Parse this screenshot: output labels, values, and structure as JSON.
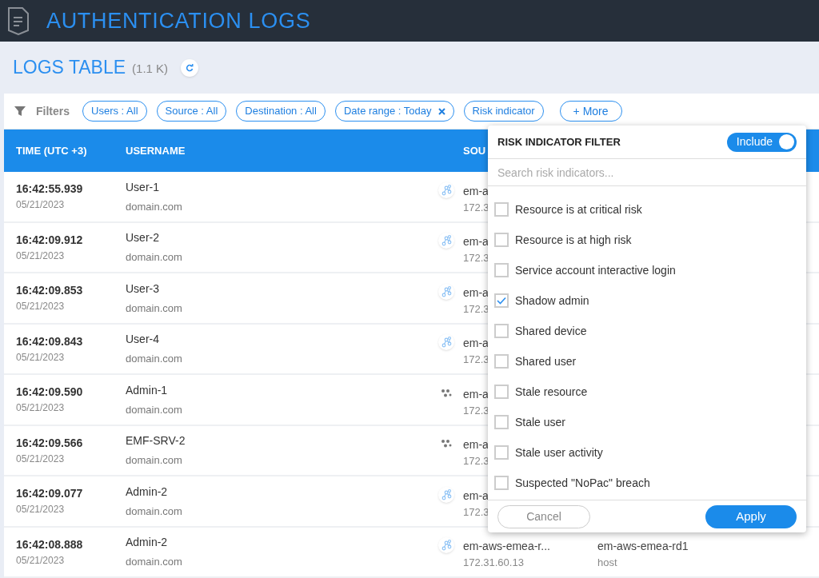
{
  "header": {
    "title": "AUTHENTICATION LOGS"
  },
  "section": {
    "title": "LOGS TABLE",
    "count": "(1.1 K)"
  },
  "filters": {
    "label": "Filters",
    "chips": [
      {
        "label": "Users : All",
        "removable": false
      },
      {
        "label": "Source : All",
        "removable": false
      },
      {
        "label": "Destination : All",
        "removable": false
      },
      {
        "label": "Date range : Today",
        "removable": true
      },
      {
        "label": "Risk indicator",
        "removable": false
      }
    ],
    "more": "+ More"
  },
  "table": {
    "columns": [
      "TIME (UTC +3)",
      "USERNAME",
      "SOU"
    ],
    "rows": [
      {
        "time": "16:42:55.939",
        "date": "05/21/2023",
        "user": "User-1",
        "domain": "domain.com",
        "kind": "link",
        "source": "em-a",
        "source_ip": "172.3"
      },
      {
        "time": "16:42:09.912",
        "date": "05/21/2023",
        "user": "User-2",
        "domain": "domain.com",
        "kind": "link",
        "source": "em-a",
        "source_ip": "172.3"
      },
      {
        "time": "16:42:09.853",
        "date": "05/21/2023",
        "user": "User-3",
        "domain": "domain.com",
        "kind": "link",
        "source": "em-a",
        "source_ip": "172.3"
      },
      {
        "time": "16:42:09.843",
        "date": "05/21/2023",
        "user": "User-4",
        "domain": "domain.com",
        "kind": "link",
        "source": "em-a",
        "source_ip": "172.3"
      },
      {
        "time": "16:42:09.590",
        "date": "05/21/2023",
        "user": "Admin-1",
        "domain": "domain.com",
        "kind": "gear",
        "source": "em-a",
        "source_ip": "172.3"
      },
      {
        "time": "16:42:09.566",
        "date": "05/21/2023",
        "user": "EMF-SRV-2",
        "domain": "domain.com",
        "kind": "gear",
        "source": "em-a",
        "source_ip": "172.3"
      },
      {
        "time": "16:42:09.077",
        "date": "05/21/2023",
        "user": "Admin-2",
        "domain": "domain.com",
        "kind": "link",
        "source": "em-a",
        "source_ip": "172.3"
      },
      {
        "time": "16:42:08.888",
        "date": "05/21/2023",
        "user": "Admin-2",
        "domain": "domain.com",
        "kind": "link",
        "source": "em-aws-emea-r...",
        "source_ip": "172.31.60.13",
        "destination": "em-aws-emea-rd1",
        "destination_type": "host"
      }
    ]
  },
  "dropdown": {
    "title": "RISK INDICATOR FILTER",
    "toggle": {
      "label": "Include",
      "on": true
    },
    "search": {
      "placeholder": "Search risk indicators..."
    },
    "options": [
      {
        "label": "Resource is at critical risk",
        "checked": false
      },
      {
        "label": "Resource is at high risk",
        "checked": false
      },
      {
        "label": "Service account interactive login",
        "checked": false
      },
      {
        "label": "Shadow admin",
        "checked": true
      },
      {
        "label": "Shared device",
        "checked": false
      },
      {
        "label": "Shared user",
        "checked": false
      },
      {
        "label": "Stale resource",
        "checked": false
      },
      {
        "label": "Stale user",
        "checked": false
      },
      {
        "label": "Stale user activity",
        "checked": false
      },
      {
        "label": "Suspected \"NoPac\" breach",
        "checked": false
      }
    ],
    "cancel": "Cancel",
    "apply": "Apply"
  }
}
